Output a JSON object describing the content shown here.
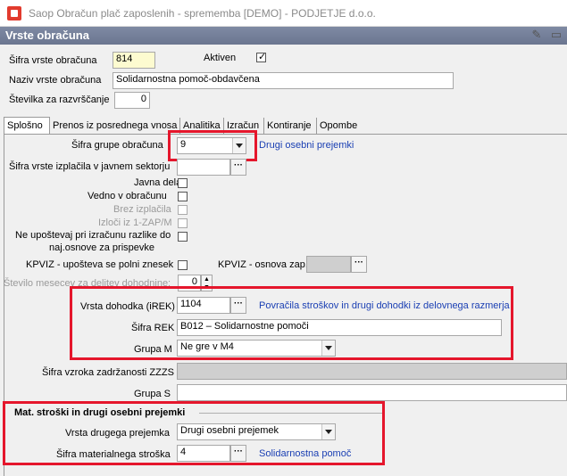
{
  "window": {
    "title": "Saop Obračun plač zaposlenih - sprememba [DEMO] - PODJETJE d.o.o."
  },
  "header": {
    "title": "Vrste obračuna"
  },
  "top": {
    "sifra_label": "Šifra vrste obračuna",
    "sifra_value": "814",
    "aktiven_label": "Aktiven",
    "aktiven_checked": true,
    "naziv_label": "Naziv vrste obračuna",
    "naziv_value": "Solidarnostna pomoč-obdavčena",
    "stevilka_label": "Številka  za razvrščanje",
    "stevilka_value": "0"
  },
  "tabs": [
    "Splošno",
    "Prenos iz posrednega vnosa",
    "Analitika",
    "Izračun",
    "Kontiranje",
    "Opombe"
  ],
  "form": {
    "grupa_label": "Šifra grupe obračuna",
    "grupa_value": "9",
    "grupa_link": "Drugi osebni prejemki",
    "izplacila_label": "Šifra vrste izplačila v javnem sektorju",
    "javna_dela_label": "Javna dela",
    "vedno_label": "Vedno v obračunu",
    "brez_label": "Brez izplačila",
    "izloci_label": "Izloči iz 1-ZAP/M",
    "neupostevaj_label_1": "Ne upoštevaj pri izračunu razlike do",
    "neupostevaj_label_2": "naj.osnove za prispevke",
    "kpviz_label": "KPVIZ - upošteva se polni znesek",
    "kpviz_osnova_label": "KPVIZ - osnova zap.",
    "stevilo_mesecev_label": "Število mesecev za delitev dohodnine:",
    "stevilo_mesecev_value": "0",
    "vrsta_dohodka_label": "Vrsta dohodka (iREK)",
    "vrsta_dohodka_value": "1104",
    "vrsta_dohodka_link": "Povračila stroškov in drugi dohodki iz delovnega razmerja",
    "sifra_rek_label": "Šifra REK",
    "sifra_rek_value": "B012 – Solidarnostne pomoči",
    "grupa_m_label": "Grupa M",
    "grupa_m_value": "Ne gre v M4",
    "zzzs_label": "Šifra vzroka zadržanosti ZZZS",
    "grupa_s_label": "Grupa S"
  },
  "mat": {
    "section_title": "Mat. stroški in drugi osebni prejemki",
    "vrsta_label": "Vrsta drugega prejemka",
    "vrsta_value": "Drugi osebni prejemek",
    "sifra_label": "Šifra materialnega stroška",
    "sifra_value": "4",
    "sifra_link": "Solidarnostna pomoč"
  }
}
